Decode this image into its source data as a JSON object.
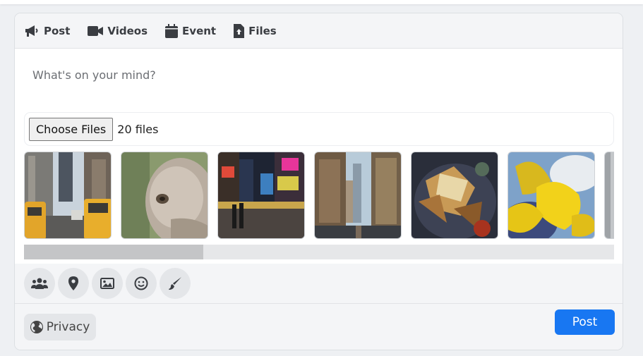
{
  "tabs": [
    {
      "label": "Post",
      "icon": "megaphone-icon"
    },
    {
      "label": "Videos",
      "icon": "video-camera-icon"
    },
    {
      "label": "Event",
      "icon": "calendar-icon"
    },
    {
      "label": "Files",
      "icon": "file-upload-icon"
    }
  ],
  "composer": {
    "placeholder": "What's on your mind?"
  },
  "file_input": {
    "button_label": "Choose Files",
    "status": "20 files"
  },
  "thumbnails": [
    {
      "subject": "city-street-taxis"
    },
    {
      "subject": "ostrich-closeup"
    },
    {
      "subject": "times-square-night"
    },
    {
      "subject": "skyscraper-street"
    },
    {
      "subject": "nachos-plate"
    },
    {
      "subject": "yellow-flower-sky"
    },
    {
      "subject": "partial-image"
    }
  ],
  "thumbnail_scroll": {
    "position_fraction": 0.0,
    "visible_fraction": 0.3
  },
  "actions": [
    {
      "icon": "users-icon"
    },
    {
      "icon": "location-pin-icon"
    },
    {
      "icon": "image-icon"
    },
    {
      "icon": "smiley-icon"
    },
    {
      "icon": "paintbrush-icon"
    }
  ],
  "footer": {
    "privacy_label": "Privacy",
    "post_label": "Post"
  },
  "colors": {
    "accent": "#1877f2",
    "panel_bg": "#f4f5f7",
    "icon": "#3a3d42"
  }
}
